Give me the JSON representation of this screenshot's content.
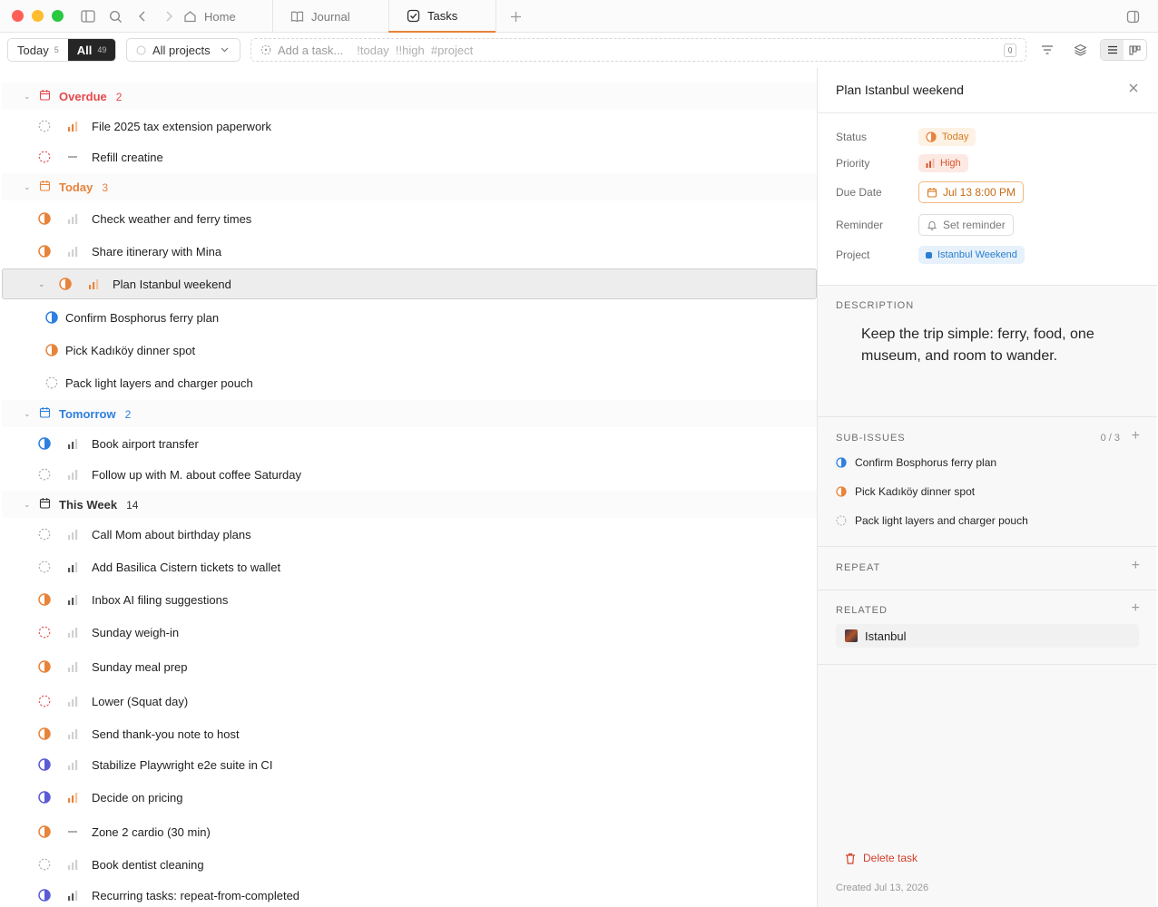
{
  "window": {
    "tabs": [
      {
        "label": "Home",
        "icon": "home-icon"
      },
      {
        "label": "Journal",
        "icon": "book-icon"
      },
      {
        "label": "Tasks",
        "icon": "check-square-icon",
        "active": true
      }
    ]
  },
  "toolbar": {
    "today_label": "Today",
    "today_count": "5",
    "all_label": "All",
    "all_count": "49",
    "projects_label": "All projects",
    "add_placeholder": "Add a task...",
    "hints": "!today  !!high  #project",
    "kbd": "Q"
  },
  "groups": [
    {
      "name": "Overdue",
      "count": "2",
      "color": "#e5484d"
    },
    {
      "name": "Today",
      "count": "3",
      "color": "#e8833a"
    },
    {
      "name": "Tomorrow",
      "count": "2",
      "color": "#2f7fe0"
    },
    {
      "name": "This Week",
      "count": "14",
      "color": "#333333"
    }
  ],
  "tasks": {
    "overdue": [
      "File 2025 tax extension paperwork",
      "Refill creatine"
    ],
    "today": [
      "Check weather and ferry times",
      "Share itinerary with Mina",
      "Plan Istanbul weekend"
    ],
    "subtasks": [
      "Confirm Bosphorus ferry plan",
      "Pick Kadıköy dinner spot",
      "Pack light layers and charger pouch"
    ],
    "tomorrow": [
      "Book airport transfer",
      "Follow up with M. about coffee Saturday"
    ],
    "week": [
      "Call Mom about birthday plans",
      "Add Basilica Cistern tickets to wallet",
      "Inbox AI filing suggestions",
      "Sunday weigh-in",
      "Sunday meal prep",
      "Lower (Squat day)",
      "Send thank-you note to host",
      "Stabilize Playwright e2e suite in CI",
      "Decide on pricing",
      "Zone 2 cardio (30 min)",
      "Book dentist cleaning",
      "Recurring tasks: repeat-from-completed"
    ]
  },
  "detail": {
    "title": "Plan Istanbul weekend",
    "labels": {
      "status": "Status",
      "priority": "Priority",
      "due": "Due Date",
      "reminder": "Reminder",
      "project": "Project"
    },
    "status": "Today",
    "priority": "High",
    "due": "Jul 13 8:00 PM",
    "reminder": "Set reminder",
    "project": "Istanbul Weekend",
    "description_label": "DESCRIPTION",
    "description": "Keep the trip simple: ferry, food, one museum, and room to wander.",
    "subissues_label": "SUB-ISSUES",
    "subissues_count": "0 / 3",
    "subissues": [
      "Confirm Bosphorus ferry plan",
      "Pick Kadıköy dinner spot",
      "Pack light layers and charger pouch"
    ],
    "repeat_label": "REPEAT",
    "related_label": "RELATED",
    "related_item": "Istanbul",
    "delete_label": "Delete task",
    "created": "Created Jul 13, 2026"
  },
  "colors": {
    "accent": "#e8833a",
    "danger": "#e5484d",
    "blue": "#2f7fe0",
    "indigo": "#5b5bd6"
  }
}
